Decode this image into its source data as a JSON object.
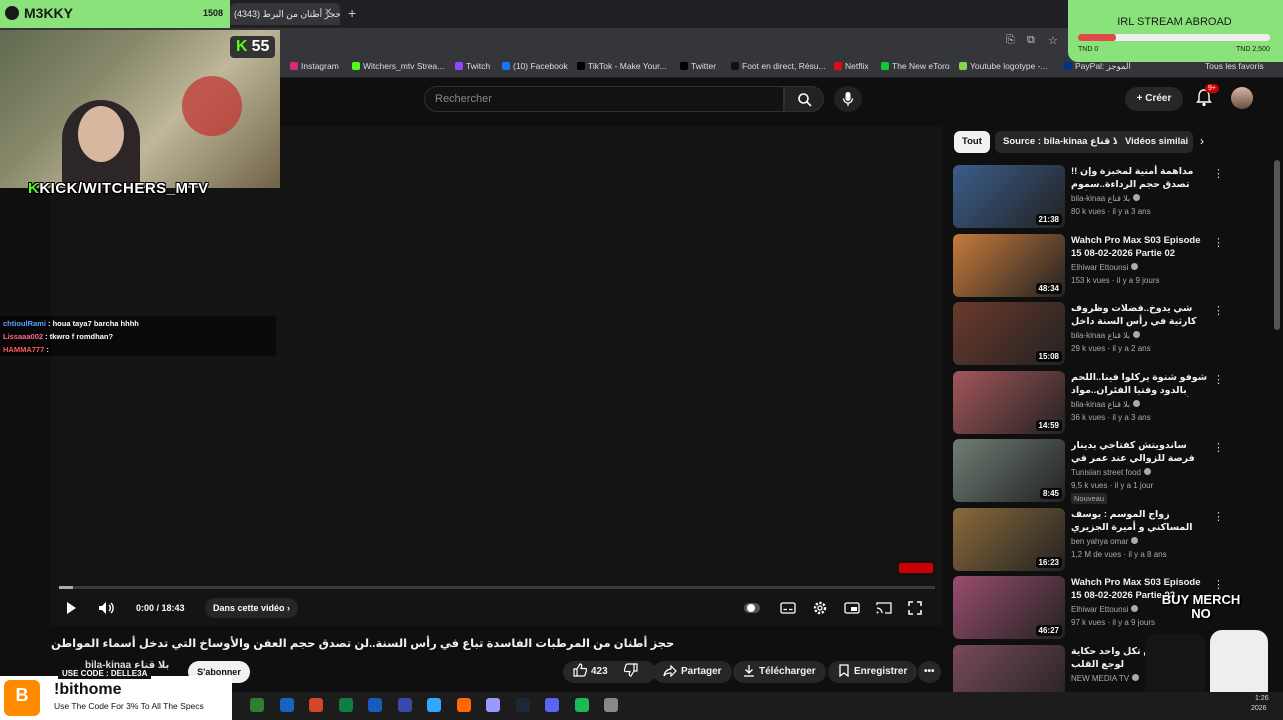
{
  "browser": {
    "active_tab_title": "حجز أطنان من البرط (4343)",
    "bookmarks": [
      {
        "label": "Instagram",
        "color": "#d6297f"
      },
      {
        "label": "Witchers_mtv Strea...",
        "color": "#53fc18"
      },
      {
        "label": "Twitch",
        "color": "#9146ff"
      },
      {
        "label": "(10) Facebook",
        "color": "#1877f2"
      },
      {
        "label": "TikTok - Make Your...",
        "color": "#000000"
      },
      {
        "label": "Twitter",
        "color": "#000000"
      },
      {
        "label": "Foot en direct, Résu...",
        "color": "#111111"
      },
      {
        "label": "Netflix",
        "color": "#e50914"
      },
      {
        "label": "The New eToro",
        "color": "#13c636"
      },
      {
        "label": "Youtube logotype -...",
        "color": "#8bd34c"
      },
      {
        "label": "PayPal: الموجز",
        "color": "#003087"
      }
    ],
    "bookmarks_all": "Tous les favoris"
  },
  "youtube": {
    "search_placeholder": "Rechercher",
    "create_label": "Créer",
    "notif_count": "9+",
    "player": {
      "time": "0:00 / 18:43",
      "chapter_label": "Dans cette vidéo",
      "progress_fraction": 0.0
    },
    "video": {
      "title": "حجز أطنان من المرطبات الفاسدة تباع في رأس السنة..لن تصدق حجم العفن والأوساخ التي تدخل أسماء المواطن",
      "channel": "bila-kinaa بلا قناع",
      "subscribe_label": "S'abonner",
      "likes": "423",
      "share_label": "Partager",
      "download_label": "Télécharger",
      "save_label": "Enregistrer"
    },
    "chips": {
      "all": "Tout",
      "source": "Source : bila-kinaa بلا قناع",
      "similar": "Vidéos similai"
    },
    "recommendations": [
      {
        "title": "!! مداهمة أمنية لمخبزة وإن تصدق حجم الرداءة..سموم تباع للمستهلك قبل رأس السنة",
        "channel": "bila-kinaa بلا قناع",
        "meta": "80 k vues · il y a 3 ans",
        "duration": "21:38",
        "new": "",
        "thumb": "#3b5d8a"
      },
      {
        "title": "Wahch Pro Max S03 Episode 15 08-02-2026 Partie 02",
        "channel": "Elhiwar Ettounsi",
        "meta": "153 k vues · il y a 9 jours",
        "duration": "48:34",
        "new": "",
        "thumb": "#c77a3c"
      },
      {
        "title": "شي يدوخ..فضلات وظروف كارثية في رأس السنة داخل محلات بيع",
        "channel": "bila-kinaa بلا قناع",
        "meta": "29 k vues · il y a 2 ans",
        "duration": "15:08",
        "new": "",
        "thumb": "#6a3a2c"
      },
      {
        "title": "شوفو شنوة يركلوا فينا..اللحم بالدود وفتيا الفئران..مواد أولية منتهية الصلوحية في",
        "channel": "bila-kinaa بلا قناع",
        "meta": "36 k vues · il y a 3 ans",
        "duration": "14:59",
        "new": "",
        "thumb": "#a3565a"
      },
      {
        "title": "ساندويتش كفتاجي بدينار فرصة للزوالي عند عمر في حي الرياض سوسة",
        "channel": "Tunisian street food",
        "meta": "9,5 k vues · il y a 1 jour",
        "duration": "8:45",
        "new": "Nouveau",
        "thumb": "#6f7d74"
      },
      {
        "title": "زواج الموسم : يوسف المساكني و أميرة الجزيري",
        "channel": "ben yahya omar",
        "meta": "1,2 M de vues · il y a 8 ans",
        "duration": "16:23",
        "new": "",
        "thumb": "#8a6a3a"
      },
      {
        "title": "Wahch Pro Max S03 Episode 15 08-02-2026 Partie 03",
        "channel": "Elhiwar Ettounsi",
        "meta": "97 k vues · il y a 9 jours",
        "duration": "46:27",
        "new": "",
        "thumb": "#9a4d6e"
      },
      {
        "title": "برشة ناس تكل واحد حكاية لوجع القلب",
        "channel": "NEW MEDIA TV",
        "meta": "",
        "duration": "",
        "new": "",
        "thumb": "#7a4a5a"
      }
    ]
  },
  "stream": {
    "streamer": "M3KKY",
    "top_count": "1508",
    "kick_viewers": "55",
    "kick_handle": "KICK/WITCHERS_MTV",
    "chat": [
      {
        "user": "chtioulRami",
        "msg": " : houa taya7 barcha hhhh",
        "color": "#5aa2ff"
      },
      {
        "user": "Lissaaa002",
        "msg": " : tkwro f romdhan?",
        "color": "#ff6a8a"
      },
      {
        "user": "HAMMA777",
        "msg": " : ",
        "color": "#ff5a5a"
      }
    ],
    "goal": {
      "title": "IRL STREAM ABROAD",
      "min": "TND 0",
      "max": "TND 2,500",
      "fraction": 0.2
    },
    "promo": {
      "code": "USE CODE : DELLE3A",
      "command": "!bithome",
      "text": "Use The Code For 3% To All The Specs"
    },
    "merch": "BUY MERCH NO"
  },
  "taskbar": {
    "time": "1:26",
    "date": "2026",
    "icons": [
      "#2e7d32",
      "#1565c0",
      "#d24726",
      "#107c41",
      "#185abd",
      "#3949ab",
      "#31a8ff",
      "#ff6a00",
      "#9999ff",
      "#1b2838",
      "#5865f2",
      "#1db954",
      "#888888"
    ]
  }
}
